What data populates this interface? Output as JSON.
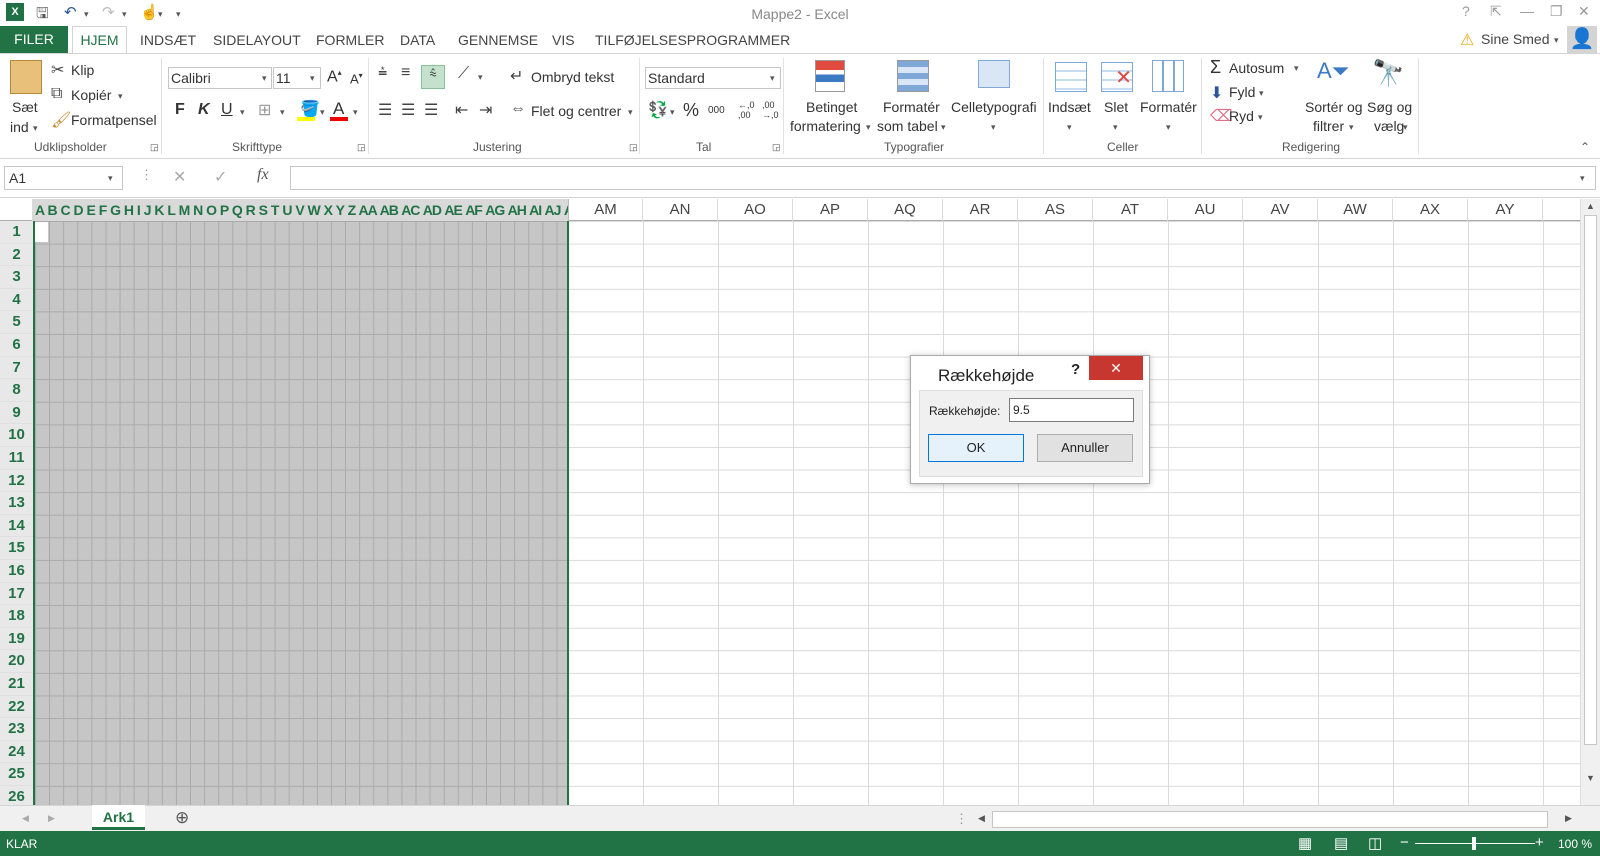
{
  "window": {
    "title": "Mappe2 - Excel"
  },
  "qat": {
    "excel_icon": "excel-icon",
    "save_icon": "save-icon",
    "undo_icon": "undo-icon",
    "redo_icon": "redo-icon",
    "touch_icon": "touch-mode-icon",
    "customize": "▾"
  },
  "win_controls": {
    "help": "?",
    "restore_ribbon": "⇱",
    "minimize": "—",
    "maximize": "❐",
    "close": "✕"
  },
  "tabs": [
    "FILER",
    "HJEM",
    "INDSÆT",
    "SIDELAYOUT",
    "FORMLER",
    "DATA",
    "GENNEMSE",
    "VIS",
    "TILFØJELSESPROGRAMMER"
  ],
  "user": {
    "name": "Sine Smed",
    "warning_icon": "warning-icon"
  },
  "ribbon": {
    "clipboard": {
      "paste": "Sæt",
      "paste2": "ind",
      "cut": "Klip",
      "copy": "Kopiér",
      "format_painter": "Formatpensel",
      "label": "Udklipsholder"
    },
    "font": {
      "name": "Calibri",
      "size": "11",
      "bold": "F",
      "italic": "K",
      "underline": "U",
      "label": "Skrifttype"
    },
    "alignment": {
      "wrap": "Ombryd tekst",
      "merge": "Flet og centrer",
      "label": "Justering"
    },
    "number": {
      "format": "Standard",
      "percent": "%",
      "thousands": "000",
      "label": "Tal"
    },
    "styles": {
      "cond1": "Betinget",
      "cond2": "formatering",
      "table1": "Formatér",
      "table2": "som tabel",
      "cell": "Celletypografi",
      "label": "Typografier"
    },
    "cells": {
      "insert": "Indsæt",
      "delete": "Slet",
      "format": "Formatér",
      "label": "Celler"
    },
    "editing": {
      "autosum": "Autosum",
      "fill": "Fyld",
      "clear": "Ryd",
      "sort1": "Sortér og",
      "sort2": "filtrer",
      "find1": "Søg og",
      "find2": "vælg",
      "label": "Redigering"
    }
  },
  "formula_bar": {
    "name_box": "A1",
    "cancel": "✕",
    "enter": "✓",
    "fx": "fx",
    "value": ""
  },
  "selected_columns": "A B C D E F G H I J K L M N O P Q R S T U V W X Y Z AA AB AC AD AE AF AG AH AI AJ AK AL",
  "columns": [
    "AM",
    "AN",
    "AO",
    "AP",
    "AQ",
    "AR",
    "AS",
    "AT",
    "AU",
    "AV",
    "AW",
    "AX",
    "AY"
  ],
  "rows": [
    "1",
    "2",
    "3",
    "4",
    "5",
    "6",
    "7",
    "8",
    "9",
    "10",
    "11",
    "12",
    "13",
    "14",
    "15",
    "16",
    "17",
    "18",
    "19",
    "20",
    "21",
    "22",
    "23",
    "24",
    "25",
    "26"
  ],
  "sheet": {
    "tab": "Ark1",
    "add": "⊕"
  },
  "status": {
    "mode": "KLAR",
    "zoom": "100 %"
  },
  "dialog": {
    "title": "Rækkehøjde",
    "help": "?",
    "label": "Rækkehøjde:",
    "value": "9.5",
    "ok": "OK",
    "cancel": "Annuller"
  }
}
